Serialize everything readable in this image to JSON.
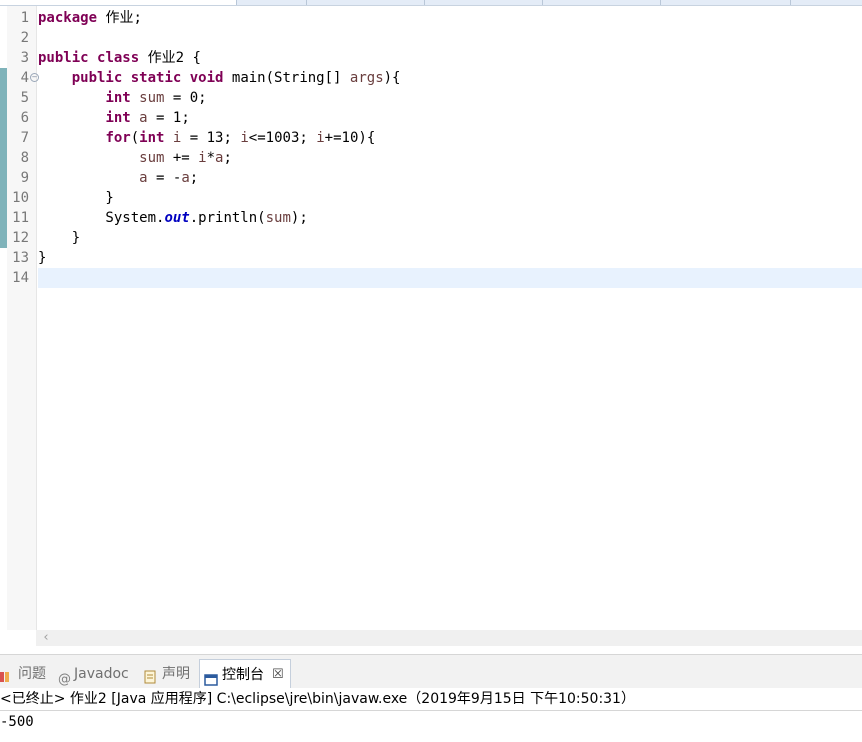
{
  "editor": {
    "line_numbers": [
      "1",
      "2",
      "3",
      "4",
      "5",
      "6",
      "7",
      "8",
      "9",
      "10",
      "11",
      "12",
      "13",
      "14"
    ],
    "lines": [
      [
        {
          "t": "package",
          "c": "kw"
        },
        {
          "t": " 作业;",
          "c": ""
        }
      ],
      [],
      [
        {
          "t": "public",
          "c": "kw"
        },
        {
          "t": " ",
          "c": ""
        },
        {
          "t": "class",
          "c": "kw"
        },
        {
          "t": " 作业2 {",
          "c": ""
        }
      ],
      [
        {
          "t": "    ",
          "c": ""
        },
        {
          "t": "public",
          "c": "kw"
        },
        {
          "t": " ",
          "c": ""
        },
        {
          "t": "static",
          "c": "kw"
        },
        {
          "t": " ",
          "c": ""
        },
        {
          "t": "void",
          "c": "kw"
        },
        {
          "t": " main(String[] ",
          "c": ""
        },
        {
          "t": "args",
          "c": "var"
        },
        {
          "t": "){",
          "c": ""
        }
      ],
      [
        {
          "t": "        ",
          "c": ""
        },
        {
          "t": "int",
          "c": "kw"
        },
        {
          "t": " ",
          "c": ""
        },
        {
          "t": "sum",
          "c": "var"
        },
        {
          "t": " = 0;",
          "c": ""
        }
      ],
      [
        {
          "t": "        ",
          "c": ""
        },
        {
          "t": "int",
          "c": "kw"
        },
        {
          "t": " ",
          "c": ""
        },
        {
          "t": "a",
          "c": "var"
        },
        {
          "t": " = 1;",
          "c": ""
        }
      ],
      [
        {
          "t": "        ",
          "c": ""
        },
        {
          "t": "for",
          "c": "kw"
        },
        {
          "t": "(",
          "c": ""
        },
        {
          "t": "int",
          "c": "kw"
        },
        {
          "t": " ",
          "c": ""
        },
        {
          "t": "i",
          "c": "var"
        },
        {
          "t": " = 13; ",
          "c": ""
        },
        {
          "t": "i",
          "c": "var"
        },
        {
          "t": "<=1003; ",
          "c": ""
        },
        {
          "t": "i",
          "c": "var"
        },
        {
          "t": "+=10){",
          "c": ""
        }
      ],
      [
        {
          "t": "            ",
          "c": ""
        },
        {
          "t": "sum",
          "c": "var"
        },
        {
          "t": " += ",
          "c": ""
        },
        {
          "t": "i",
          "c": "var"
        },
        {
          "t": "*",
          "c": ""
        },
        {
          "t": "a",
          "c": "var"
        },
        {
          "t": ";",
          "c": ""
        }
      ],
      [
        {
          "t": "            ",
          "c": ""
        },
        {
          "t": "a",
          "c": "var"
        },
        {
          "t": " = -",
          "c": ""
        },
        {
          "t": "a",
          "c": "var"
        },
        {
          "t": ";",
          "c": ""
        }
      ],
      [
        {
          "t": "        }",
          "c": ""
        }
      ],
      [
        {
          "t": "        System.",
          "c": ""
        },
        {
          "t": "out",
          "c": "field"
        },
        {
          "t": ".println(",
          "c": ""
        },
        {
          "t": "sum",
          "c": "var"
        },
        {
          "t": ");",
          "c": ""
        }
      ],
      [
        {
          "t": "    }",
          "c": ""
        }
      ],
      [
        {
          "t": "}",
          "c": ""
        }
      ],
      []
    ],
    "current_line_index": 13
  },
  "views": {
    "tabs": [
      {
        "label": "问题",
        "icon": "problems-icon"
      },
      {
        "label": "Javadoc",
        "icon": "at-icon"
      },
      {
        "label": "声明",
        "icon": "declaration-icon"
      },
      {
        "label": "控制台",
        "icon": "console-icon"
      }
    ],
    "close_glyph": "☒"
  },
  "console": {
    "title": "<已终止> 作业2 [Java 应用程序] C:\\eclipse\\jre\\bin\\javaw.exe（2019年9月15日 下午10:50:31）",
    "output": "-500"
  },
  "colors": {
    "keyword": "#7f0055",
    "variable": "#6a3e3e",
    "field": "#0000c0",
    "current_line": "#e8f2fe",
    "change_marker": "#7fb3ba"
  }
}
